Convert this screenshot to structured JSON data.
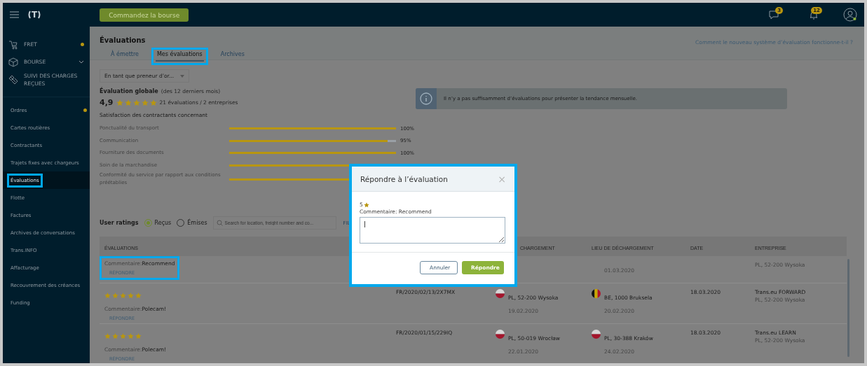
{
  "topbar": {
    "logo": "T",
    "order_button": "Commandez la bourse",
    "messages_badge": "3",
    "notifications_badge": "12"
  },
  "sidebar": {
    "sections": [
      {
        "kind": "freight",
        "label": "FRET",
        "dot": true,
        "chevron": false
      },
      {
        "kind": "exchange",
        "label": "BOURSE",
        "dot": false,
        "chevron": true
      },
      {
        "kind": "tracking",
        "label": "SUIVI DES CHARGES REÇUES",
        "dot": false,
        "chevron": false
      }
    ],
    "items": [
      {
        "label": "Ordres",
        "dot": true,
        "selected": false,
        "highlighted": false
      },
      {
        "label": "Cartes routières",
        "dot": false,
        "selected": false,
        "highlighted": false
      },
      {
        "label": "Contractants",
        "dot": false,
        "selected": false,
        "highlighted": false
      },
      {
        "label": "Trajets fixes avec chargeurs",
        "dot": false,
        "selected": false,
        "highlighted": false
      },
      {
        "label": "Évaluations",
        "dot": false,
        "selected": true,
        "highlighted": true
      },
      {
        "label": "Flotte",
        "dot": false,
        "selected": false,
        "highlighted": false
      },
      {
        "label": "Factures",
        "dot": false,
        "selected": false,
        "highlighted": false
      },
      {
        "label": "Archives de conversations",
        "dot": false,
        "selected": false,
        "highlighted": false
      },
      {
        "label": "Trans.INFO",
        "dot": false,
        "selected": false,
        "highlighted": false
      },
      {
        "label": "Affacturage",
        "dot": false,
        "selected": false,
        "highlighted": false
      },
      {
        "label": "Recouvrement des créances",
        "dot": false,
        "selected": false,
        "highlighted": false
      },
      {
        "label": "Funding",
        "dot": false,
        "selected": false,
        "highlighted": false
      }
    ]
  },
  "page": {
    "title": "Évaluations",
    "help_link": "Comment le nouveau système d’évaluation fonctionne-t-il ?",
    "tabs": [
      {
        "label": "À émettre",
        "selected": false,
        "highlighted": false
      },
      {
        "label": "Mes évaluations",
        "selected": true,
        "highlighted": true
      },
      {
        "label": "Archives",
        "selected": false,
        "highlighted": false
      }
    ]
  },
  "role_dropdown": "En tant que preneur d’or...",
  "global_rating": {
    "title": "Évaluation globale",
    "period": "(des 12 derniers mois)",
    "score": "4,9",
    "stars": 5,
    "summary": "21 évaluations / 2 entreprises"
  },
  "satisfaction": {
    "title": "Satisfaction des contractants concernant",
    "metrics": [
      {
        "name": "Ponctualité du transport",
        "level": 1,
        "reading": "100%"
      },
      {
        "name": "Communication",
        "level": 0.95,
        "reading": "95%"
      },
      {
        "name": "Fourniture des documents",
        "level": 1,
        "reading": "100%"
      },
      {
        "name": "Soin de la marchandise",
        "level": 1
      },
      {
        "name": "Conformité du service par rapport aux conditions préétablies",
        "level": 1
      }
    ]
  },
  "info_message": "Il n’y a pas suffisamment d’évaluations pour présenter la tendance mensuelle.",
  "filters": {
    "label": "User ratings",
    "options": [
      {
        "label": "Reçus",
        "selected": true
      },
      {
        "label": "Émises",
        "selected": false
      }
    ],
    "search_placeholder": "Search for location, freight number and co...",
    "filter_link": "FIL"
  },
  "table": {
    "columns": [
      "ÉVALUATIONS",
      "",
      "CHARGEMENT",
      "LIEU DE DÉCHARGEMENT",
      "DATE",
      "ENTREPRISE"
    ],
    "rows": [
      {
        "highlighted": true,
        "comment_label": "Commentaire:",
        "comment": "Recommend",
        "reply": "RÉPONDRE",
        "unloading": {
          "date": "01.03.2020"
        },
        "company_address": "PL, 52-200 Wysoka"
      },
      {
        "highlighted": false,
        "stars": 5,
        "comment_label": "Commentaire:",
        "comment": "Polecam!",
        "reply": "RÉPONDRE",
        "number": "FR/2020/02/13/2X7MX",
        "loading": {
          "place": "PL, 52-200 Wysoka",
          "date": "19.02.2020",
          "kind": "pl"
        },
        "unloading": {
          "place": "BE, 1000 Bruksela",
          "date": "20.02.2020",
          "kind": "be"
        },
        "date": "18.03.2020",
        "company": "Trans.eu FORWARD",
        "company_address": "PL, 52-200 Wysoka"
      },
      {
        "highlighted": false,
        "stars": 5,
        "comment_label": "Commentaire:",
        "comment": "Polecam!",
        "reply": "RÉPONDRE",
        "number": "FR/2020/01/15/229IQ",
        "loading": {
          "place": "PL, 50-019 Wrocław",
          "date": "22.01.2020",
          "kind": "pl"
        },
        "unloading": {
          "place": "PL, 30-388 Kraków",
          "date": "24.02.2020",
          "kind": "pl"
        },
        "date": "18.03.2020",
        "company": "Trans.eu LEARN",
        "company_address": "PL, 52-200 Wysoka"
      }
    ]
  },
  "modal": {
    "title": "Répondre à l’évaluation",
    "close": "×",
    "rating": "5",
    "comment": "Commentaire: Recommend",
    "reply_value": "|",
    "cancel": "Annuler",
    "submit": "Répondre",
    "highlighted": true
  }
}
